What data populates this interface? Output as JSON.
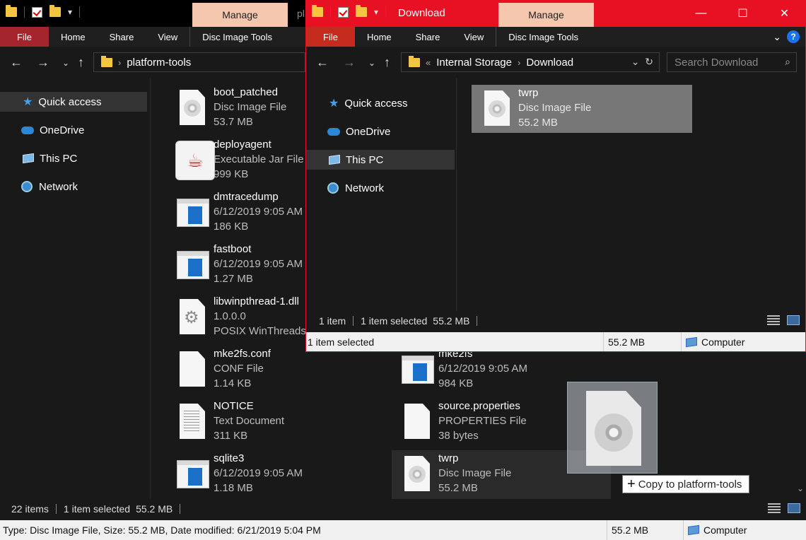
{
  "back_window": {
    "tab_label": "Manage",
    "title_peek": "pl",
    "ribbon_tabs": [
      "File",
      "Home",
      "Share",
      "View",
      "Disc Image Tools"
    ],
    "address": {
      "crumbs": [
        "platform-tools"
      ]
    },
    "nav": [
      {
        "label": "Quick access",
        "icon": "star-icon"
      },
      {
        "label": "OneDrive",
        "icon": "cloud-icon"
      },
      {
        "label": "This PC",
        "icon": "computer-icon"
      },
      {
        "label": "Network",
        "icon": "network-icon"
      }
    ],
    "files_left": [
      {
        "name": "boot_patched",
        "line2": "Disc Image File",
        "line3": "53.7 MB",
        "icon": "disc-image-icon"
      },
      {
        "name": "deployagent",
        "line2": "Executable Jar File",
        "line3": "999 KB",
        "icon": "java-icon"
      },
      {
        "name": "dmtracedump",
        "line2": "6/12/2019 9:05 AM",
        "line3": "186 KB",
        "icon": "application-icon"
      },
      {
        "name": "fastboot",
        "line2": "6/12/2019 9:05 AM",
        "line3": "1.27 MB",
        "icon": "application-icon"
      },
      {
        "name": "libwinpthread-1.dll",
        "line2": "1.0.0.0",
        "line3": "POSIX WinThreads",
        "icon": "dll-gears-icon"
      },
      {
        "name": "mke2fs.conf",
        "line2": "CONF File",
        "line3": "1.14 KB",
        "icon": "blank-file-icon"
      },
      {
        "name": "NOTICE",
        "line2": "Text Document",
        "line3": "311 KB",
        "icon": "text-file-icon"
      },
      {
        "name": "sqlite3",
        "line2": "6/12/2019 9:05 AM",
        "line3": "1.18 MB",
        "icon": "application-icon"
      }
    ],
    "files_right": [
      {
        "name": "mke2fs",
        "line2": "6/12/2019 9:05 AM",
        "line3": "984 KB",
        "icon": "application-icon"
      },
      {
        "name": "source.properties",
        "line2": "PROPERTIES File",
        "line3": "38 bytes",
        "icon": "blank-file-icon"
      },
      {
        "name": "twrp",
        "line2": "Disc Image File",
        "line3": "55.2 MB",
        "icon": "disc-image-icon"
      }
    ],
    "status": {
      "items": "22 items",
      "selected": "1 item selected",
      "size": "55.2 MB"
    },
    "infobar": {
      "details": "Type: Disc Image File, Size: 55.2 MB, Date modified: 6/21/2019 5:04 PM",
      "size": "55.2 MB",
      "location": "Computer"
    }
  },
  "front_window": {
    "title": "Download",
    "tab_label": "Manage",
    "ribbon_tabs": [
      "File",
      "Home",
      "Share",
      "View",
      "Disc Image Tools"
    ],
    "address": {
      "overflow": "«",
      "crumbs": [
        "Internal Storage",
        "Download"
      ]
    },
    "search_placeholder": "Search Download",
    "nav": [
      {
        "label": "Quick access",
        "icon": "star-icon"
      },
      {
        "label": "OneDrive",
        "icon": "cloud-icon"
      },
      {
        "label": "This PC",
        "icon": "computer-icon"
      },
      {
        "label": "Network",
        "icon": "network-icon"
      }
    ],
    "files": [
      {
        "name": "twrp",
        "line2": "Disc Image File",
        "line3": "55.2 MB",
        "icon": "disc-image-icon"
      }
    ],
    "status": {
      "items": "1 item",
      "selected": "1 item selected",
      "size": "55.2 MB"
    },
    "infobar": {
      "details": "1 item selected",
      "size": "55.2 MB",
      "location": "Computer"
    }
  },
  "drag": {
    "tooltip": "Copy to platform-tools"
  }
}
